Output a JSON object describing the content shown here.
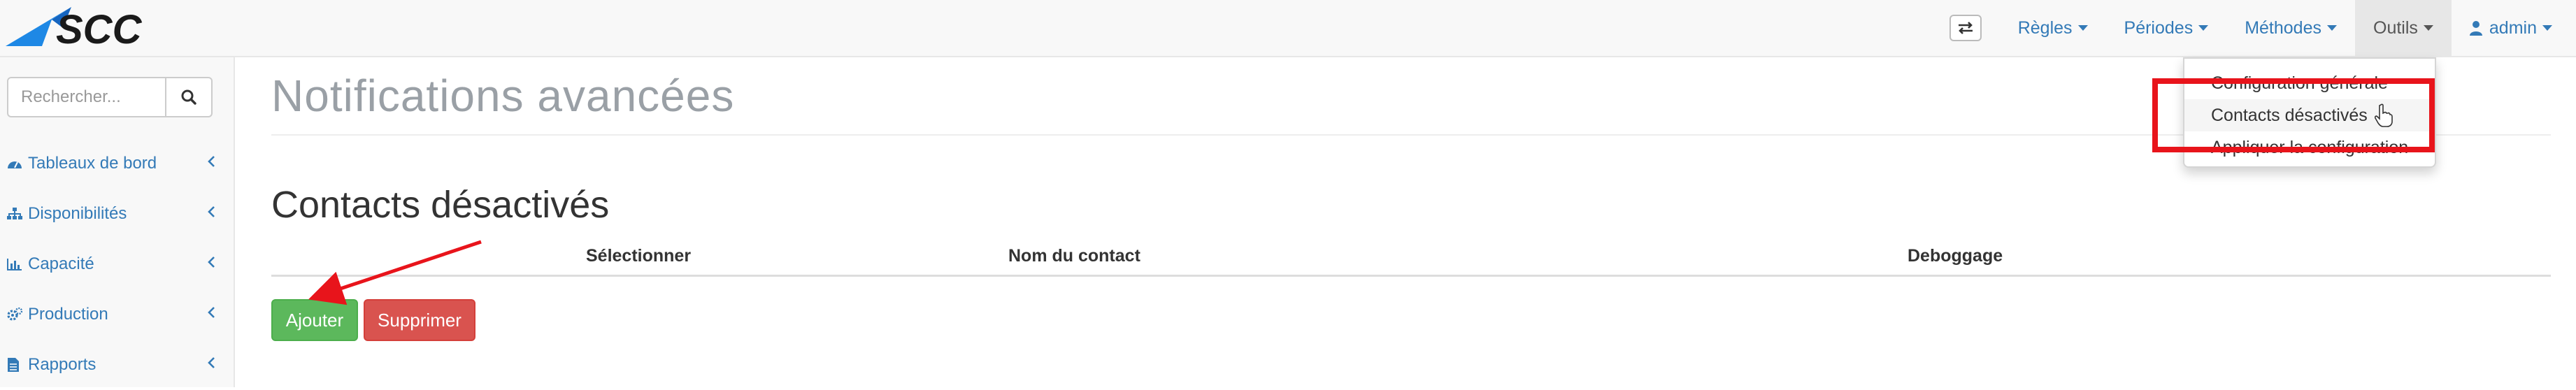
{
  "app": {
    "logo_text": "SCC"
  },
  "navbar": {
    "items": [
      {
        "label": "Règles"
      },
      {
        "label": "Périodes"
      },
      {
        "label": "Méthodes"
      },
      {
        "label": "Outils"
      },
      {
        "label": "admin"
      }
    ]
  },
  "dropdown": {
    "items": [
      {
        "label": "Configuration générale"
      },
      {
        "label": "Contacts désactivés"
      },
      {
        "label": "Appliquer la configuration"
      }
    ]
  },
  "sidebar": {
    "search_placeholder": "Rechercher...",
    "items": [
      {
        "label": "Tableaux de bord",
        "icon": "dashboard-icon"
      },
      {
        "label": "Disponibilités",
        "icon": "sitemap-icon"
      },
      {
        "label": "Capacité",
        "icon": "bar-chart-icon"
      },
      {
        "label": "Production",
        "icon": "cogs-icon"
      },
      {
        "label": "Rapports",
        "icon": "file-icon"
      }
    ]
  },
  "main": {
    "page_title": "Notifications avancées",
    "section_title": "Contacts désactivés",
    "table": {
      "columns": [
        "Sélectionner",
        "Nom du contact",
        "Deboggage"
      ]
    },
    "buttons": {
      "add_label": "Ajouter",
      "delete_label": "Supprimer"
    }
  },
  "colors": {
    "link": "#337ab7",
    "success": "#5cb85c",
    "danger": "#d9534f",
    "annotation": "#e8141b"
  }
}
